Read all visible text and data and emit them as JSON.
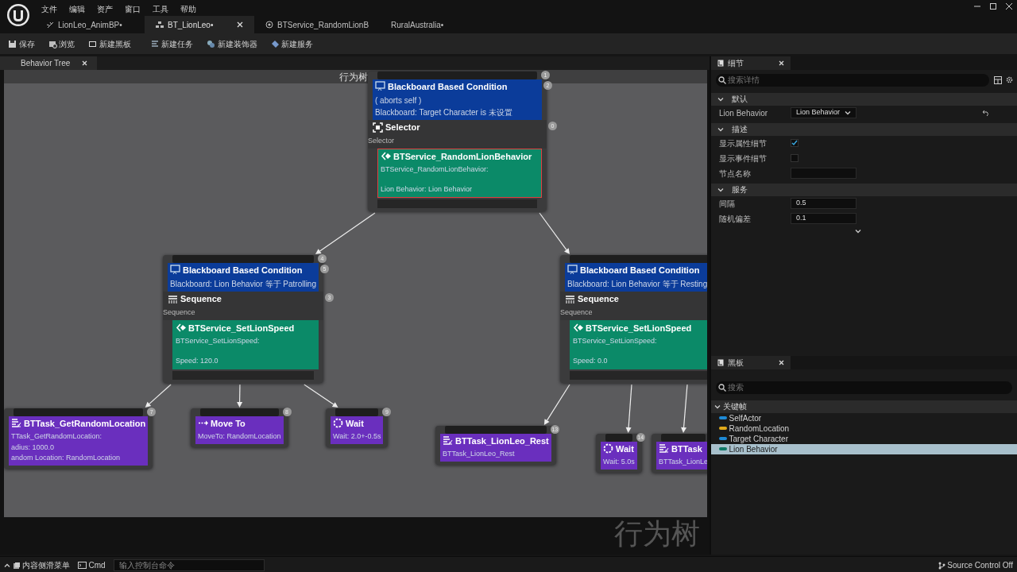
{
  "menu": [
    "文件",
    "编辑",
    "资产",
    "窗口",
    "工具",
    "帮助"
  ],
  "doc_tabs": [
    {
      "label": "LionLeo_AnimBP•",
      "kind": "anim",
      "selected": false
    },
    {
      "label": "BT_LionLeo•",
      "kind": "tree",
      "selected": true
    },
    {
      "label": "BTService_RandomLionB",
      "kind": "blueprint",
      "selected": false
    },
    {
      "label": "RuralAustralia•",
      "kind": "level",
      "selected": false
    }
  ],
  "toolbar": [
    {
      "label": "保存",
      "kind": "save"
    },
    {
      "label": "浏览",
      "kind": "browse"
    },
    {
      "label": "新建黑板",
      "kind": "board"
    },
    {
      "label": "新建任务",
      "kind": "task"
    },
    {
      "label": "新建装饰器",
      "kind": "decorator"
    },
    {
      "label": "新建服务",
      "kind": "service"
    }
  ],
  "graph": {
    "tab": "Behavior Tree",
    "title": "行为树",
    "watermark": "行为树",
    "nodes": [
      {
        "badge": "1",
        "blocks": [
          {
            "kind": "decorator",
            "title": "Blackboard Based Condition",
            "lines": [
              "( aborts self )",
              "Blackboard: Target Character is 未设置"
            ],
            "badge": "2"
          },
          {
            "kind": "selector",
            "title": "Selector",
            "lines": [
              "Selector"
            ],
            "badge": "0"
          },
          {
            "kind": "service",
            "title": "BTService_RandomLionBehavior",
            "lines": [
              "BTService_RandomLionBehavior:",
              "Lion Behavior: Lion Behavior"
            ],
            "selected": true
          }
        ]
      },
      {
        "badge": "4",
        "blocks": [
          {
            "kind": "decorator",
            "title": "Blackboard Based Condition",
            "lines": [
              "Blackboard: Lion Behavior 等于 Patrolling"
            ],
            "badge": "5"
          },
          {
            "kind": "sequence",
            "title": "Sequence",
            "lines": [
              "Sequence"
            ],
            "badge": "3"
          },
          {
            "kind": "service",
            "title": "BTService_SetLionSpeed",
            "lines": [
              "BTService_SetLionSpeed:",
              "Speed: 120.0"
            ],
            "selected": false
          }
        ]
      },
      {
        "blocks": [
          {
            "kind": "decorator",
            "title": "Blackboard Based Condition",
            "lines": [
              "Blackboard: Lion Behavior 等于 Resting"
            ]
          },
          {
            "kind": "sequence",
            "title": "Sequence",
            "lines": [
              "Sequence"
            ]
          },
          {
            "kind": "service",
            "title": "BTService_SetLionSpeed",
            "lines": [
              "BTService_SetLionSpeed:",
              "Speed: 0.0"
            ],
            "selected": false
          }
        ]
      },
      {
        "badge": "7",
        "blocks": [
          {
            "kind": "task",
            "title": "BTTask_GetRandomLocation",
            "lines": [
              "TTask_GetRandomLocation:",
              "adius: 1000.0",
              "andom Location: RandomLocation"
            ]
          }
        ]
      },
      {
        "badge": "8",
        "blocks": [
          {
            "kind": "moveto",
            "title": "Move To",
            "lines": [
              "MoveTo: RandomLocation"
            ]
          }
        ]
      },
      {
        "badge": "9",
        "blocks": [
          {
            "kind": "wait",
            "title": "Wait",
            "lines": [
              "Wait: 2.0+-0.5s"
            ]
          }
        ]
      },
      {
        "badge": "13",
        "blocks": [
          {
            "kind": "task",
            "title": "BTTask_LionLeo_Rest",
            "lines": [
              "BTTask_LionLeo_Rest"
            ]
          }
        ]
      },
      {
        "badge": "14",
        "blocks": [
          {
            "kind": "wait",
            "title": "Wait",
            "lines": [
              "Wait: 5.0s"
            ]
          }
        ]
      },
      {
        "blocks": [
          {
            "kind": "task",
            "title": "BTTask",
            "lines": [
              "BTTask_LionLe"
            ]
          }
        ]
      }
    ]
  },
  "details": {
    "tab": "细节",
    "search_placeholder": "搜索详情",
    "sections": [
      {
        "title": "默认",
        "expanded": true,
        "rows": [
          {
            "kind": "dropdown",
            "label": "Lion Behavior",
            "value": "Lion Behavior"
          }
        ]
      },
      {
        "title": "描述",
        "expanded": true,
        "rows": [
          {
            "kind": "checkbox",
            "label": "显示属性细节",
            "checked": true
          },
          {
            "kind": "checkbox",
            "label": "显示事件细节",
            "checked": false
          },
          {
            "kind": "text",
            "label": "节点名称"
          }
        ]
      },
      {
        "title": "服务",
        "expanded": true,
        "rows": [
          {
            "kind": "text",
            "label": "间隔",
            "value": "0.5"
          },
          {
            "kind": "text",
            "label": "随机偏差",
            "value": "0.1"
          }
        ]
      }
    ]
  },
  "blackboard": {
    "tab": "黑板",
    "search_placeholder": "搜索",
    "category": {
      "label": "关键帧",
      "expanded": true,
      "keys": [
        {
          "name": "SelfActor",
          "color": "#1e8ad6",
          "selected": false
        },
        {
          "name": "RandomLocation",
          "color": "#e0a91a",
          "selected": false
        },
        {
          "name": "Target Character",
          "color": "#1e8ad6",
          "selected": false
        },
        {
          "name": "Lion Behavior",
          "color": "#0e7866",
          "selected": true
        }
      ]
    }
  },
  "status_bar": {
    "content_drawer": "内容侧滑菜单",
    "cmd": "Cmd",
    "console_placeholder": "输入控制台命令",
    "source_control": "Source Control Off"
  }
}
